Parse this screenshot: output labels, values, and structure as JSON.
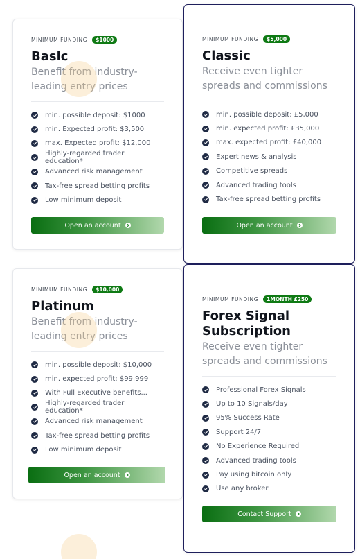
{
  "plans": [
    {
      "funding_label": "MINIMUM FUNDING",
      "funding_badge": "$1000",
      "title": "Basic",
      "subtitle_lines": [
        "Benefit from industry-",
        "leading entry prices"
      ],
      "features": [
        "min. possible deposit: $1000",
        "min. Expected profit: $3,500",
        "max. Expected profit: $12,000",
        "Highly-regarded trader education*",
        "Advanced risk management",
        "Tax-free spread betting profits",
        "Low minimum deposit"
      ],
      "cta_label": "Open an account"
    },
    {
      "funding_label": "MINIMUM FUNDING",
      "funding_badge": "$5,000",
      "title": "Classic",
      "subtitle_lines": [
        "Receive even tighter",
        "spreads and commissions"
      ],
      "features": [
        "min. possible deposit: £5,000",
        "min. expected profit: £35,000",
        "max. expected profit: £40,000",
        "Expert news & analysis",
        "Competitive spreads",
        "Advanced trading tools",
        "Tax-free spread betting profits"
      ],
      "cta_label": "Open an account"
    },
    {
      "funding_label": "MINIMUM FUNDING",
      "funding_badge": "$10,000",
      "title": "Platinum",
      "subtitle_lines": [
        "Benefit from industry-",
        "leading entry prices"
      ],
      "features": [
        "min. possible deposit: $10,000",
        "min. expected profit: $99,999",
        "With Full Executive benefits...",
        "Highly-regarded trader education*",
        "Advanced risk management",
        "Tax-free spread betting profits",
        "Low minimum deposit"
      ],
      "cta_label": "Open an account"
    },
    {
      "funding_label": "MINIMUM FUNDING",
      "funding_badge": "1MONTH £250",
      "title_lines": [
        "Forex Signal",
        "Subscription"
      ],
      "subtitle_lines": [
        "Receive even tighter",
        "spreads and commissions"
      ],
      "features": [
        "Professional Forex Signals",
        "Up to 10 Signals/day",
        "95% Success Rate",
        "Support 24/7",
        "No Experience Required",
        "Advanced trading tools",
        "Pay using bitcoin only",
        "Use any broker"
      ],
      "cta_label": "Contact Support"
    }
  ],
  "colors": {
    "accent_green": "#0f7a14",
    "featured_border": "#1e1f5c",
    "check": "#1f2a44"
  },
  "icons": {
    "check": "check-circle-icon",
    "cta_arrow": "arrow-right-circle-icon"
  }
}
